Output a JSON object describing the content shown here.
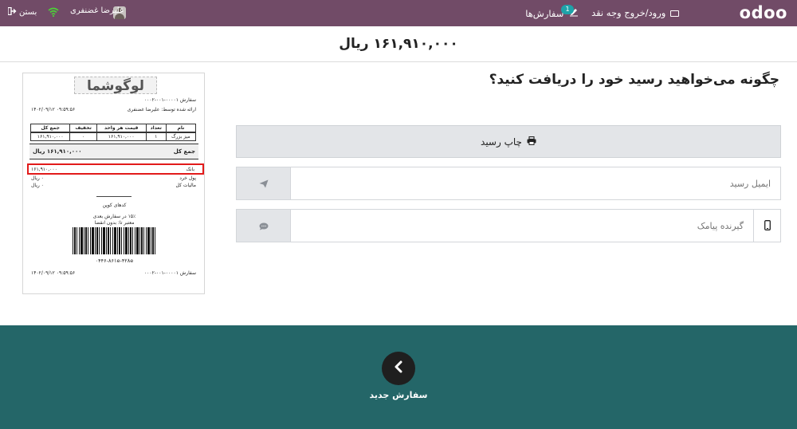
{
  "topbar": {
    "logo": "odoo",
    "cash_in_out": "ورود/خروج وجه نقد",
    "orders": "سفارش‌ها",
    "orders_badge": "1",
    "user_name": "علیرضا غضنفری",
    "close": "بستن",
    "colors": {
      "bar": "#714b67",
      "badge": "#1ea3a9",
      "wifi": "#4cd137"
    }
  },
  "amount_due": "۱۶۱,۹۱۰,۰۰۰ ریال",
  "question": "چگونه می‌خواهید رسید خود را دریافت کنید؟",
  "actions": {
    "print_label": "چاپ رسید",
    "email_placeholder": "ایمیل رسید",
    "sms_placeholder": "گیرنده پیامک"
  },
  "receipt": {
    "logo_text": "لوگوشما",
    "order_ref": "سفارش ۰۰۰۰۱-۰۰۱-۰۰۰۲",
    "served_by": "ارائه شده توسط: علیرضا غضنفری",
    "datetime": "۱۴۰۲/۰۹/۱۲ ۰۹:۵۹:۵۶",
    "columns": [
      "نام",
      "تعداد",
      "قیمت هر واحد",
      "تخفیف",
      "جمع کل"
    ],
    "rows": [
      [
        "میز بزرگ",
        "۱",
        "۱۶۱,۹۱۰,۰۰۰",
        "۰",
        "۱۶۱,۹۱۰,۰۰۰"
      ]
    ],
    "total_label": "جمع کل",
    "total_value": "۱۶۱,۹۱۰,۰۰۰ ریال",
    "payment_label": "بانک",
    "payment_value": "۱۶۱,۹۱۰,۰۰۰",
    "change_label": "پول خرد",
    "change_value": "۰ ریال",
    "tax_label": "مالیات کل",
    "tax_value": "۰ ریال",
    "coupon_title": "کدهای کوپن",
    "coupon_desc": "۱۵٪ در سفارش بعدی",
    "coupon_valid": "معتبر تا: بدون انقضا",
    "barcode_number": "۰۴۴۶-۸۶۱e-۴۲۸e",
    "footer_datetime": "۱۴۰۲/۰۹/۱۲ ۰۹:۵۹:۵۶",
    "footer_ref": "سفارش ۰۰۰۰۱-۰۰۱-۰۰۰۲"
  },
  "new_order": "سفارش جدید",
  "icons": {
    "cash": "cash-icon",
    "orders": "edit-icon",
    "wifi": "wifi-icon",
    "close": "sign-out-icon",
    "print": "printer-icon",
    "send": "send-icon",
    "sms": "chat-icon",
    "phone": "mobile-icon",
    "back": "chevron-left-icon"
  }
}
